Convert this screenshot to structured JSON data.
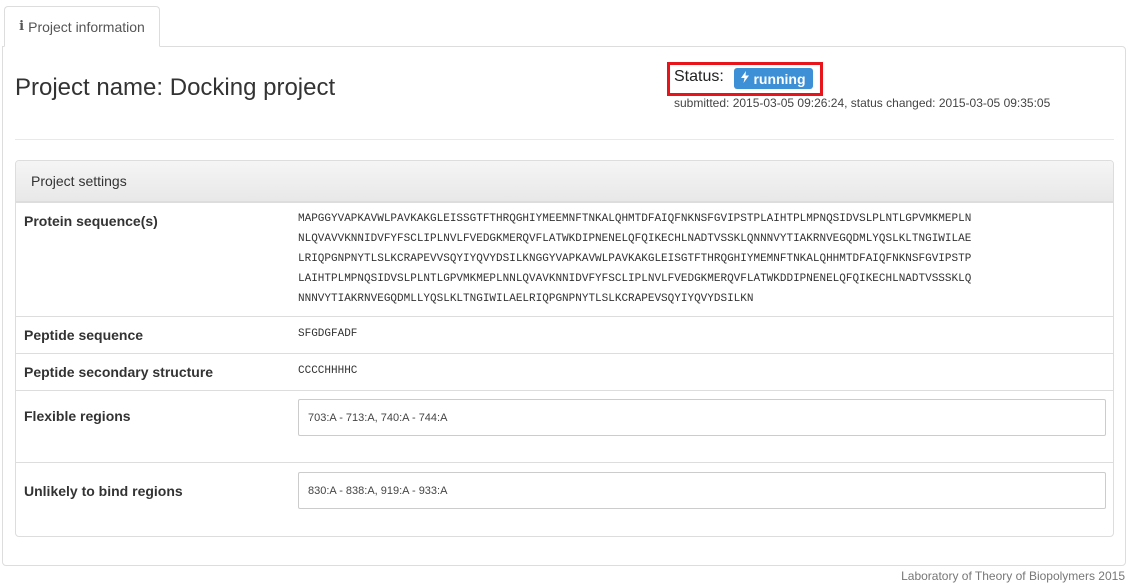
{
  "tab": {
    "icon": "info-icon",
    "label": "Project information"
  },
  "project": {
    "title": "Project name: Docking project"
  },
  "status": {
    "label": "Status:",
    "badge_icon": "bolt-icon",
    "badge_text": "running",
    "badge_color": "#3d8fd6",
    "highlight_color": "#e8141b",
    "submitted_line": "submitted: 2015-03-05 09:26:24, status changed: 2015-03-05 09:35:05"
  },
  "settings": {
    "heading": "Project settings",
    "protein": {
      "label": "Protein sequence(s)",
      "lines": [
        "MAPGGYVAPKAVWLPAVKAKGLEISSGTFTHRQGHIYMEEMNFTNKALQHMTDFAIQFNKNSFGVIPSTPLAIHTPLMPNQSIDVSLPLNTLGPVMKMEPLN",
        "NLQVAVVKNNIDVFYFSCLIPLNVLFVEDGKMERQVFLATWKDIPNENELQFQIKECHLNADTVSSKLQNNNVYTIAKRNVEGQDMLYQSLKLTNGIWILAE",
        "LRIQPGNPNYTLSLKCRAPEVVSQYIYQVYDSILKNGGYVAPKAVWLPAVKAKGLEISGTFTHRQGHIYMEMNFTNKALQHHMTDFAIQFNKNSFGVIPSTP",
        "LAIHTPLMPNQSIDVSLPLNTLGPVMKMEPLNNLQVAVKNNIDVFYFSCLIPLNVLFVEDGKMERQVFLATWKDDIPNENELQFQIKECHLNADTVSSSKLQ",
        "NNNVYTIAKRNVEGQDMLLYQSLKLTNGIWILAELRIQPGNPNYTLSLKCRAPEVSQYIYQVYDSILKN"
      ]
    },
    "peptide": {
      "label": "Peptide sequence",
      "value": "SFGDGFADF"
    },
    "secondary": {
      "label": "Peptide secondary structure",
      "value": "CCCCHHHHC"
    },
    "flexible": {
      "label": "Flexible regions",
      "value": "703:A - 713:A, 740:A - 744:A"
    },
    "unlikely": {
      "label": "Unlikely to bind regions",
      "value": "830:A - 838:A, 919:A - 933:A"
    }
  },
  "footer": {
    "text": "Laboratory of Theory of Biopolymers 2015"
  }
}
